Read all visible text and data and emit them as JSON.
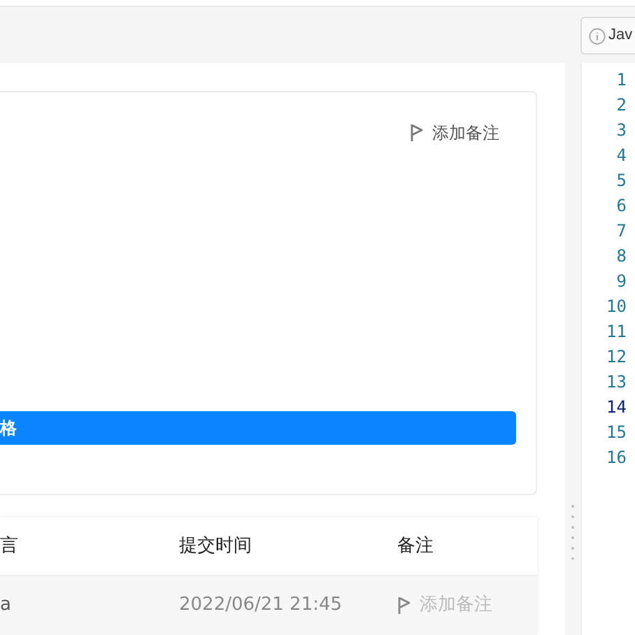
{
  "card": {
    "note_action": "添加备注",
    "bar_label": "格"
  },
  "table": {
    "columns": [
      "言",
      "提交时间",
      "备注"
    ],
    "rows": [
      {
        "cells": [
          "a",
          "2022/06/21 21:45"
        ],
        "note_action": "添加备注",
        "note_disabled": true
      }
    ]
  },
  "editor": {
    "tab": {
      "label": "Jav"
    },
    "lines": [
      {
        "number": "1",
        "active": false
      },
      {
        "number": "2",
        "active": false
      },
      {
        "number": "3",
        "active": false
      },
      {
        "number": "4",
        "active": false
      },
      {
        "number": "5",
        "active": false
      },
      {
        "number": "6",
        "active": false
      },
      {
        "number": "7",
        "active": false
      },
      {
        "number": "8",
        "active": false
      },
      {
        "number": "9",
        "active": false
      },
      {
        "number": "10",
        "active": false
      },
      {
        "number": "11",
        "active": false
      },
      {
        "number": "12",
        "active": false
      },
      {
        "number": "13",
        "active": false
      },
      {
        "number": "14",
        "active": true
      },
      {
        "number": "15",
        "active": false
      },
      {
        "number": "16",
        "active": false
      }
    ]
  }
}
